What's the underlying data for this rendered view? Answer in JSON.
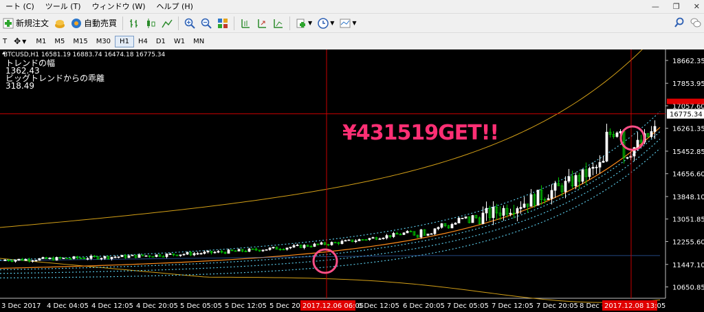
{
  "menu": {
    "items": [
      "ート (C)",
      "ツール (T)",
      "ウィンドウ (W)",
      "ヘルプ (H)"
    ]
  },
  "window_controls": {
    "minimize": "—",
    "restore": "❐",
    "close": "✕"
  },
  "toolbar": {
    "new_order": "新規注文",
    "auto_trade": "自動売買"
  },
  "timeframes": [
    "M1",
    "M5",
    "M15",
    "M30",
    "H1",
    "H4",
    "D1",
    "W1",
    "MN"
  ],
  "active_timeframe": "H1",
  "chart_header": "BTCUSD,H1  16581.19 16883.74 16474.18 16775.34",
  "indicators": {
    "trend_width_label": "トレンドの幅",
    "trend_width_value": "1362.43",
    "deviation_label": "ビッグトレンドからの乖離",
    "deviation_value": "318.49"
  },
  "promo_text": "¥431519GET!!",
  "price_axis": [
    "18662.35",
    "17853.95",
    "17057.60",
    "16261.35",
    "15452.85",
    "14656.60",
    "13848.10",
    "13051.85",
    "12255.60",
    "11447.10",
    "10650.85"
  ],
  "current_price_label": "16775.34",
  "time_axis": [
    "3 Dec 2017",
    "4 Dec 04:05",
    "4 Dec 12:05",
    "4 Dec 20:05",
    "5 Dec 05:05",
    "5 Dec 12:05",
    "5 Dec 20:",
    "6 Dec 12:05",
    "6 Dec 20:05",
    "7 Dec 05:05",
    "7 Dec 12:05",
    "7 Dec 20:05",
    "8 Dec 0"
  ],
  "time_markers": [
    "2017.12.06 06:05",
    "2017.12.08 13:05"
  ],
  "colors": {
    "background": "#000000",
    "bull_candle": "#ffffff",
    "bear_candle": "#00c800",
    "ma_orange": "#ff8c1a",
    "band_dots": "#5ac8e6",
    "envelope": "#d4a017",
    "marker_line": "#c80000",
    "circle": "#ff4f87",
    "promo": "#ff2f74"
  },
  "chart_data": {
    "type": "candlestick",
    "symbol": "BTCUSD",
    "timeframe": "H1",
    "ylim": [
      10250,
      19050
    ],
    "current_price": 16775.34
  }
}
